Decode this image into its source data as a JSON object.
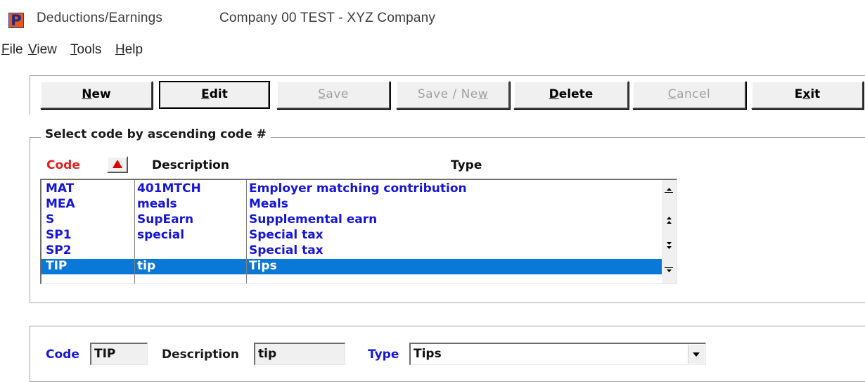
{
  "window": {
    "app_icon_letter": "P",
    "title": "Deductions/Earnings",
    "company": "Company 00  TEST - XYZ Company"
  },
  "menu": [
    {
      "label": "File",
      "ul": "F",
      "rest": "ile"
    },
    {
      "label": "View",
      "ul": "V",
      "rest": "iew"
    },
    {
      "label": "Tools",
      "ul": "T",
      "rest": "ools"
    },
    {
      "label": "Help",
      "ul": "H",
      "rest": "elp"
    }
  ],
  "toolbar": {
    "new": {
      "pre": "",
      "ul": "N",
      "post": "ew"
    },
    "edit": {
      "pre": "",
      "ul": "E",
      "post": "dit"
    },
    "save": {
      "pre": "",
      "ul": "S",
      "post": "ave"
    },
    "save_new": {
      "pre": "Save / Ne",
      "ul": "w",
      "post": ""
    },
    "delete": {
      "pre": "",
      "ul": "D",
      "post": "elete"
    },
    "cancel": {
      "pre": "",
      "ul": "C",
      "post": "ancel"
    },
    "exit": {
      "pre": "E",
      "ul": "x",
      "post": "it"
    }
  },
  "list": {
    "group_title": "Select code by ascending code #",
    "headers": {
      "code": "Code",
      "description": "Description",
      "type": "Type"
    },
    "rows": [
      {
        "code": "MAT",
        "description": "401MTCH",
        "type": "Employer matching contribution"
      },
      {
        "code": "MEA",
        "description": "meals",
        "type": "Meals"
      },
      {
        "code": "S",
        "description": "SupEarn",
        "type": "Supplemental earn"
      },
      {
        "code": "SP1",
        "description": "special",
        "type": "Special tax"
      },
      {
        "code": "SP2",
        "description": "",
        "type": "Special tax"
      },
      {
        "code": "TIP",
        "description": "tip",
        "type": "Tips"
      }
    ],
    "selected_index": 5
  },
  "detail": {
    "code_label": "Code",
    "code_value": "TIP",
    "description_label": "Description",
    "description_value": "tip",
    "type_label": "Type",
    "type_value": "Tips"
  },
  "colors": {
    "row_text": "#1515d8",
    "selected_row_bg": "#0a78d7",
    "code_header": "#e02020",
    "detail_label_blue": "#1515d8"
  }
}
